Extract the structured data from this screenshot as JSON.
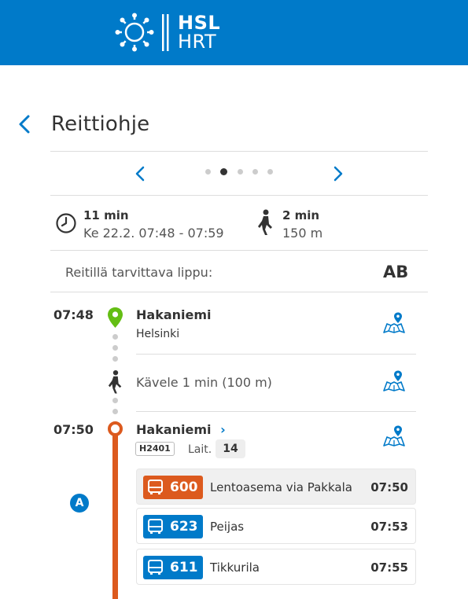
{
  "header": {
    "logo_line1": "HSL",
    "logo_line2": "HRT",
    "color": "#007ac9"
  },
  "page": {
    "title": "Reittiohje",
    "back_icon": "chevron-left-icon"
  },
  "pager": {
    "prev_icon": "chevron-left-icon",
    "next_icon": "chevron-right-icon",
    "pages": 5,
    "active_index": 1
  },
  "summary": {
    "duration": "11 min",
    "time_range": "Ke 22.2. 07:48 - 07:59",
    "walk_duration": "2 min",
    "walk_distance": "150 m"
  },
  "ticket": {
    "label": "Reitillä tarvittava lippu:",
    "zones": "AB"
  },
  "itinerary": {
    "start": {
      "time": "07:48",
      "name": "Hakaniemi",
      "city": "Helsinki",
      "marker_color": "#64be14"
    },
    "walk": {
      "text": "Kävele 1 min (100 m)"
    },
    "board": {
      "time": "07:50",
      "name": "Hakaniemi",
      "name_chevron": "›",
      "stop_code": "H2401",
      "platform_label": "Lait.",
      "platform": "14",
      "line_color": "#dc5a1e"
    },
    "leg_marker": "A",
    "departures": [
      {
        "route": "600",
        "destination": "Lentoasema via Pakkala",
        "time": "07:50",
        "color": "#dc5a1e",
        "selected": true
      },
      {
        "route": "623",
        "destination": "Peijas",
        "time": "07:53",
        "color": "#007ac9",
        "selected": false
      },
      {
        "route": "611",
        "destination": "Tikkurila",
        "time": "07:55",
        "color": "#007ac9",
        "selected": false
      }
    ]
  }
}
